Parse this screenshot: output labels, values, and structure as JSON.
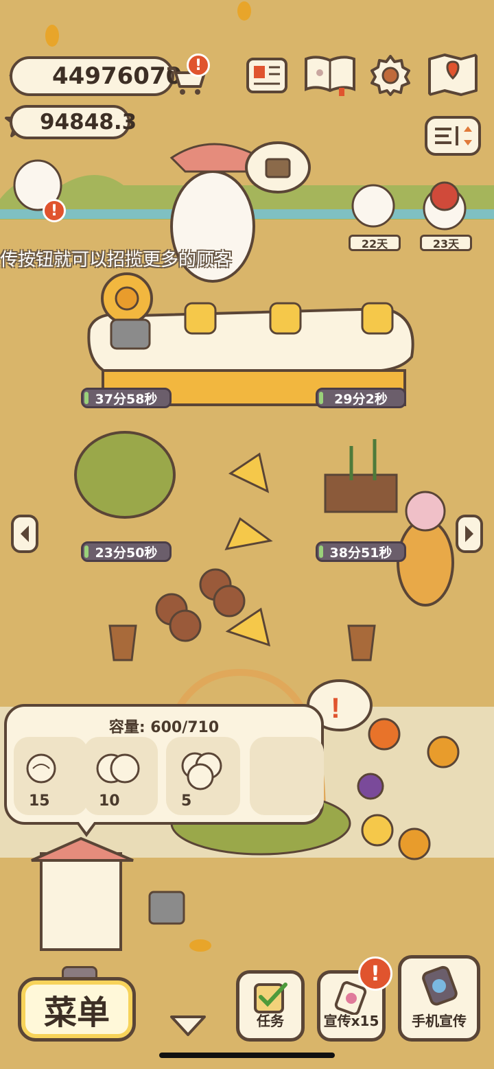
{
  "currency": {
    "fish": "44976070",
    "star": "94848.3"
  },
  "tip_text": "宣传按钮就可以招揽更多的顾客",
  "visitors": [
    {
      "days": "22天"
    },
    {
      "days": "23天"
    }
  ],
  "timers": [
    "37分58秒",
    "29分2秒",
    "23分50秒",
    "38分51秒"
  ],
  "capacity": {
    "title": "容量: 600/710",
    "slots": [
      {
        "count": "15"
      },
      {
        "count": "10"
      },
      {
        "count": "5"
      },
      {
        "count": ""
      }
    ]
  },
  "buttons": {
    "menu": "菜单",
    "tasks": "任务",
    "promo": "宣传x15",
    "phone_promo": "手机宣传"
  },
  "colors": {
    "background": "#d9b56a",
    "alert": "#e0542e",
    "timer": "#6b5e6b",
    "panel": "#fbf3df"
  }
}
